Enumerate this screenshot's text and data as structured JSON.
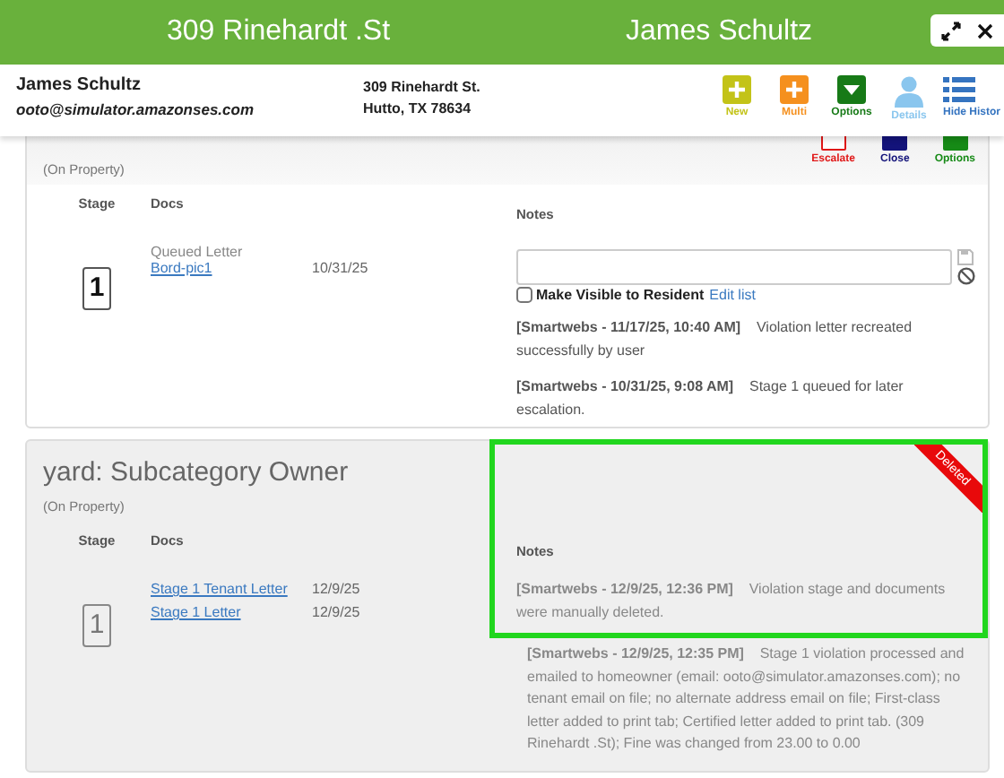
{
  "header": {
    "address": "309 Rinehardt .St",
    "name": "James Schultz"
  },
  "contact": {
    "name": "James Schultz",
    "email": "ooto@simulator.amazonses.com",
    "address_line1": "309 Rinehardt St.",
    "address_line2": "Hutto, TX 78634"
  },
  "toolbar": [
    {
      "kind": "new",
      "label": "New"
    },
    {
      "kind": "multi",
      "label": "Multi"
    },
    {
      "kind": "options",
      "label": "Options"
    },
    {
      "kind": "details",
      "label": "Details"
    },
    {
      "kind": "history",
      "label": "Hide Histor"
    }
  ],
  "violations": [
    {
      "location": "(On Property)",
      "deleted": false,
      "actions": [
        {
          "kind": "escalate",
          "label": "Escalate"
        },
        {
          "kind": "close",
          "label": "Close"
        },
        {
          "kind": "options",
          "label": "Options"
        }
      ],
      "columns": {
        "stage": "Stage",
        "docs": "Docs",
        "notes": "Notes"
      },
      "stage": "1",
      "docs_label": "Queued Letter",
      "docs": [
        {
          "name": "Bord-pic1",
          "date": "10/31/25"
        }
      ],
      "editor": {
        "checkbox_label": "Make Visible to Resident",
        "checked": false,
        "link": "Edit list"
      },
      "notes": [
        "**[Smartwebs - 11/17/25, 10:40 AM]**    Violation letter recreated successfully by user",
        "**[Smartwebs - 10/31/25, 9:08 AM]**    Stage 1 queued for later escalation."
      ]
    },
    {
      "title": "yard: Subcategory Owner",
      "location": "(On Property)",
      "deleted": true,
      "deleted_label": "Deleted",
      "columns": {
        "stage": "Stage",
        "docs": "Docs",
        "notes": "Notes"
      },
      "stage": "1",
      "docs": [
        {
          "name": "Stage 1 Tenant Letter",
          "date": "12/9/25"
        },
        {
          "name": "Stage 1 Letter",
          "date": "12/9/25"
        }
      ],
      "notes": [
        "**[Smartwebs - 12/9/25, 12:36 PM]**    Violation stage and documents were manually deleted.",
        "**[Smartwebs - 12/9/25, 12:35 PM]**    Stage 1 violation processed and emailed to homeowner (email: ooto@simulator.amazonses.com); no tenant email on file; no alternate address email on file; First-class letter added to print tab; Certified letter added to print tab. (309 Rinehardt .St); Fine was changed from 23.00 to 0.00"
      ]
    }
  ]
}
